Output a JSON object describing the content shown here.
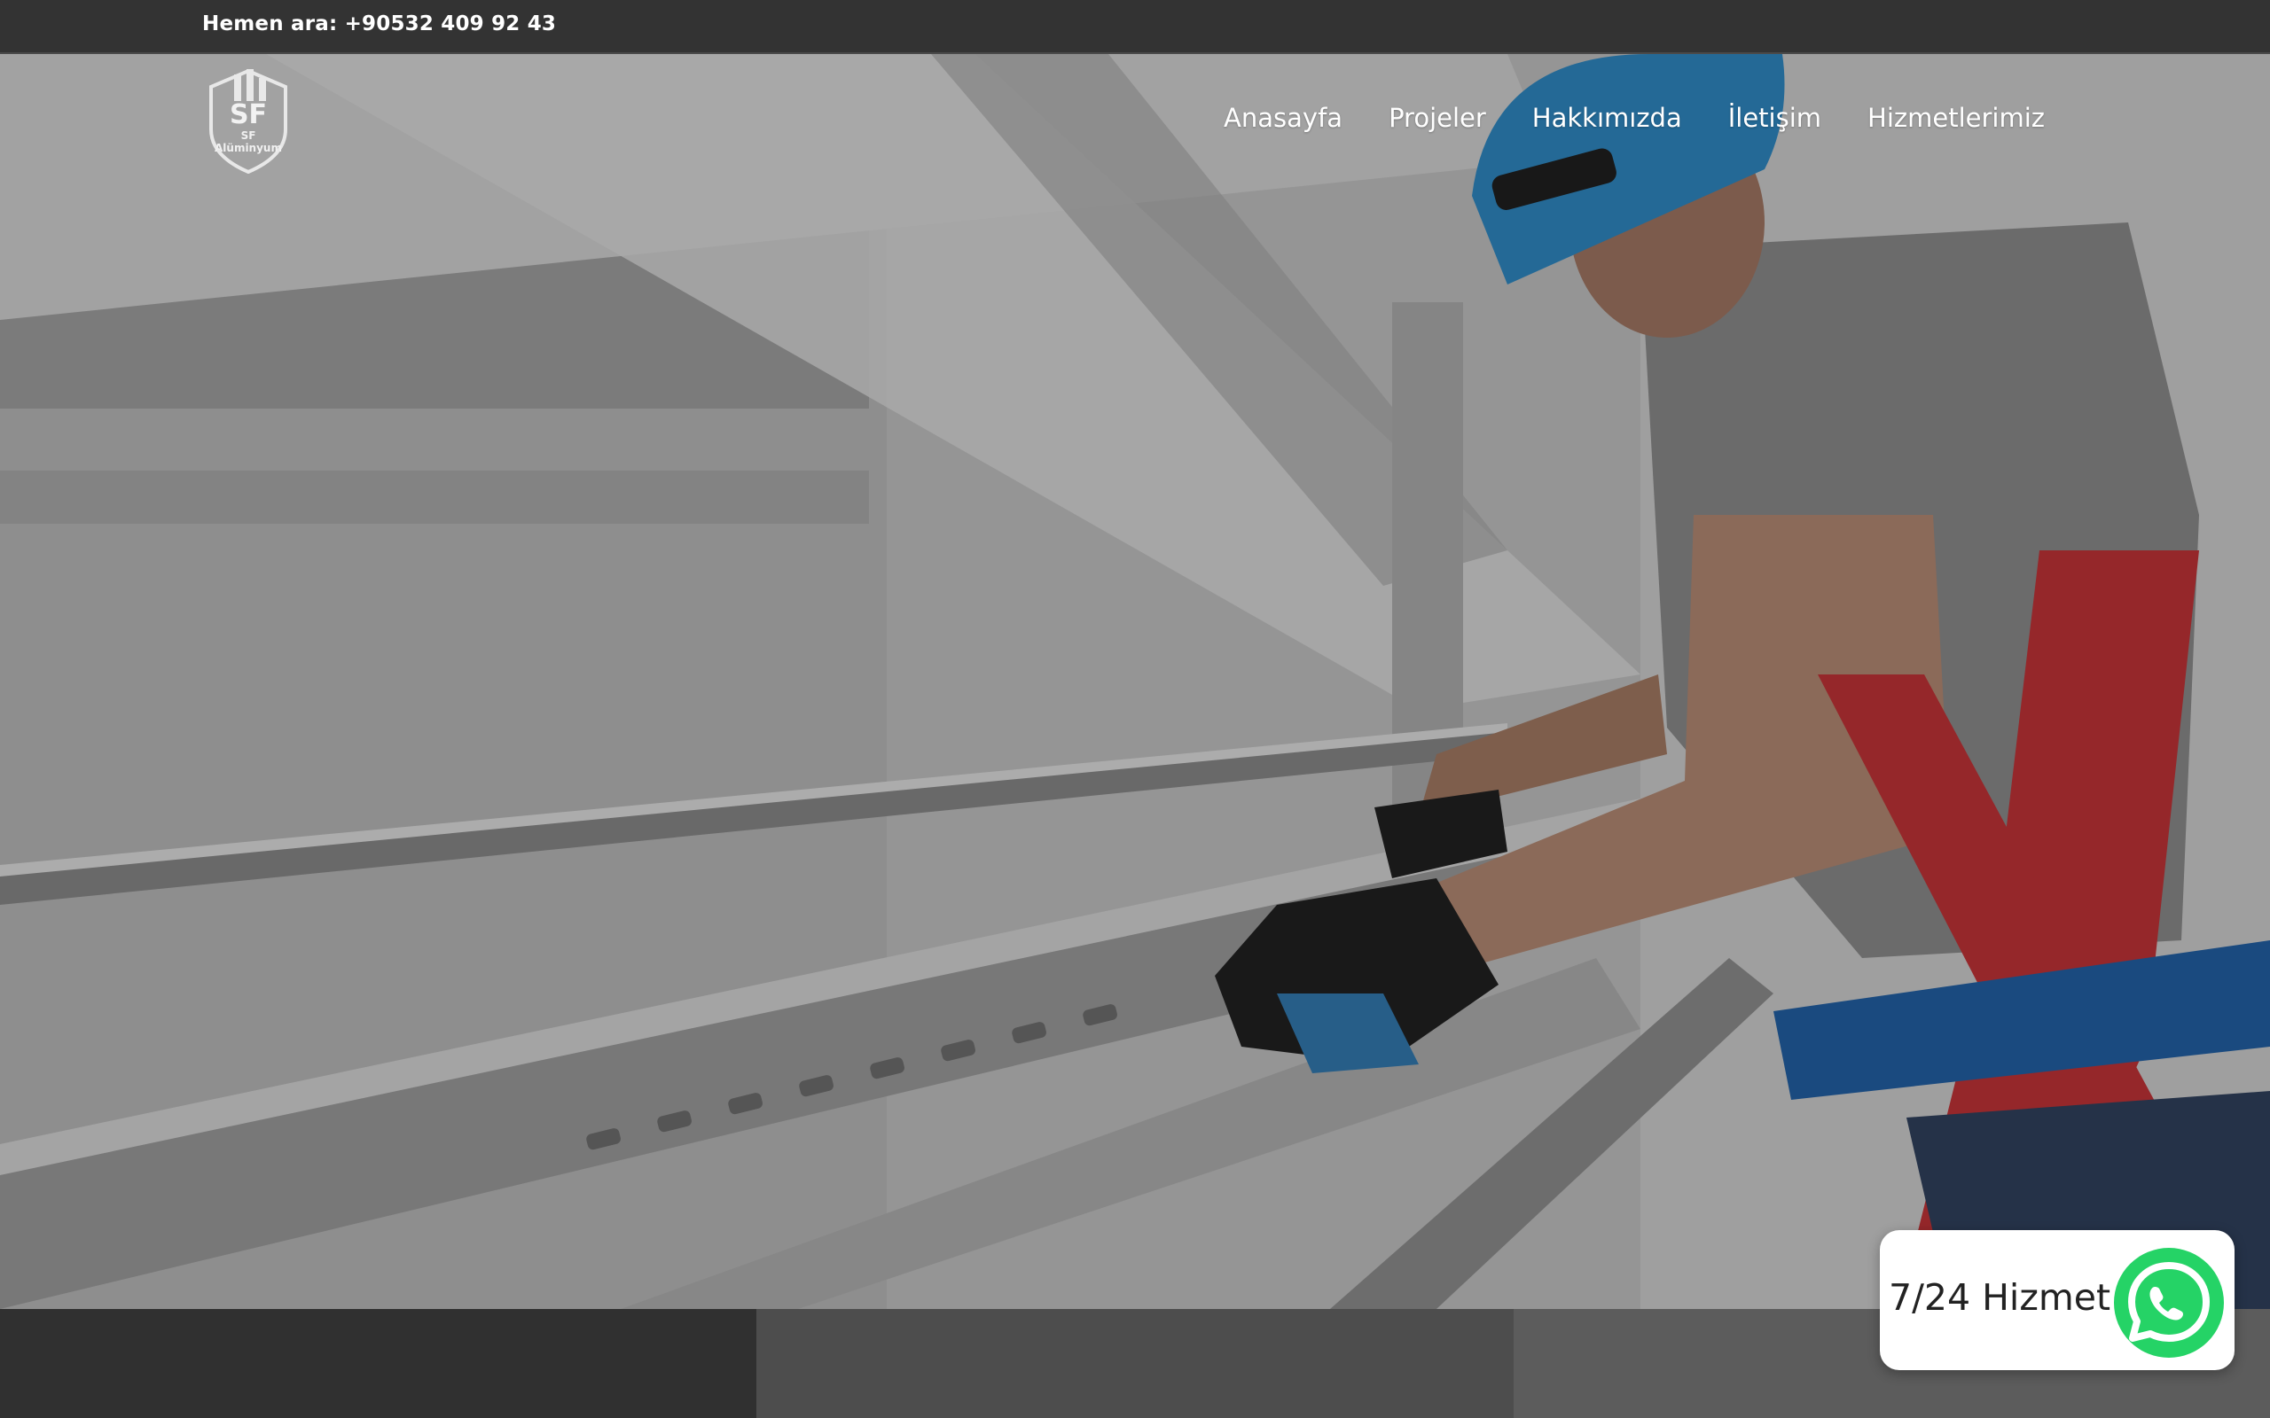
{
  "topbar": {
    "phone_text": "Hemen ara: +90532 409 92 43"
  },
  "brand": {
    "logo_text": "SF Alüminyum",
    "logo_initials": "SF"
  },
  "nav": {
    "items": [
      {
        "label": "Anasayfa"
      },
      {
        "label": "Projeler"
      },
      {
        "label": "Hakkımızda"
      },
      {
        "label": "İletişim"
      },
      {
        "label": "Hizmetlerimiz"
      }
    ]
  },
  "whatsapp": {
    "label": "7/24 Hizmet",
    "icon": "whatsapp-icon",
    "color": "#25d366"
  },
  "colors": {
    "topbar": "#333333",
    "panel_dark": "#303030",
    "panel_mid": "#4d4d4d",
    "panel_light": "#5c5c5c"
  }
}
